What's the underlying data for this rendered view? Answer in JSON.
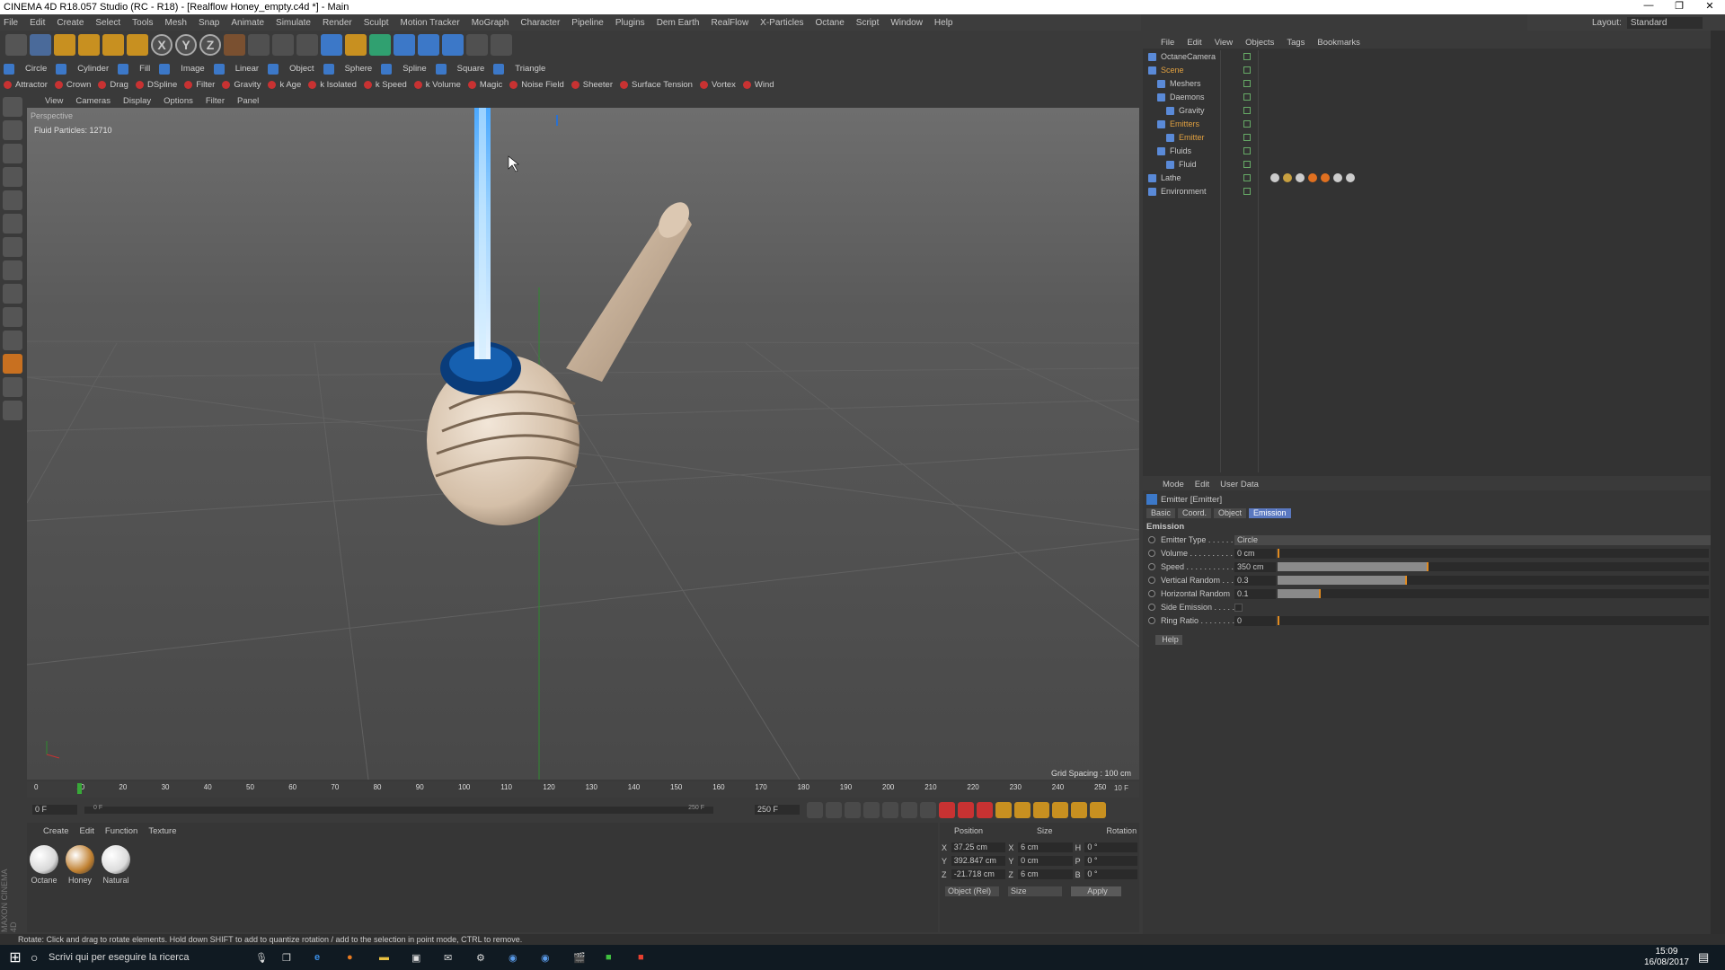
{
  "window": {
    "title": "CINEMA 4D R18.057 Studio (RC - R18) - [Realflow Honey_empty.c4d *] - Main",
    "buttons": [
      "—",
      "❐",
      "✕"
    ]
  },
  "menubar": [
    "File",
    "Edit",
    "Create",
    "Select",
    "Tools",
    "Mesh",
    "Snap",
    "Animate",
    "Simulate",
    "Render",
    "Sculpt",
    "Motion Tracker",
    "MoGraph",
    "Character",
    "Pipeline",
    "Plugins",
    "Dem Earth",
    "RealFlow",
    "X-Particles",
    "Octane",
    "Script",
    "Window",
    "Help"
  ],
  "layout": {
    "label": "Layout:",
    "value": "Standard"
  },
  "toolbar1": [
    "undo",
    "select",
    "move",
    "scale",
    "rotate",
    "rotate2",
    "X",
    "Y",
    "Z",
    "coord",
    "render-view",
    "render",
    "render-settings",
    "cube",
    "pen",
    "subdiv",
    "array",
    "deformer",
    "scene",
    "camera",
    "light"
  ],
  "toolbar2": [
    "Circle",
    "Cylinder",
    "Fill",
    "Image",
    "Linear",
    "Object",
    "Sphere",
    "Spline",
    "Square",
    "Triangle"
  ],
  "toolbar3": [
    "Attractor",
    "Crown",
    "Drag",
    "DSpline",
    "Filter",
    "Gravity",
    "k Age",
    "k Isolated",
    "k Speed",
    "k Volume",
    "Magic",
    "Noise Field",
    "Sheeter",
    "Surface Tension",
    "Vortex",
    "Wind"
  ],
  "viewport": {
    "menu": [
      "View",
      "Cameras",
      "Display",
      "Options",
      "Filter",
      "Panel"
    ],
    "label": "Perspective",
    "particles": "Fluid Particles: 12710",
    "grid_spacing": "Grid Spacing : 100 cm"
  },
  "timeline": {
    "ticks": [
      "0",
      "10",
      "20",
      "30",
      "40",
      "50",
      "60",
      "70",
      "80",
      "90",
      "100",
      "110",
      "120",
      "130",
      "140",
      "150",
      "160",
      "170",
      "180",
      "190",
      "200",
      "210",
      "220",
      "230",
      "240",
      "250"
    ],
    "end_frame_label": "10 F",
    "current": "0 F",
    "start": "0 F",
    "range_end": "250 F",
    "range_end2": "250 F"
  },
  "material_manager": {
    "menu": [
      "Create",
      "Edit",
      "Function",
      "Texture"
    ],
    "materials": [
      {
        "name": "Octane",
        "color": "#d8d8d8"
      },
      {
        "name": "Honey",
        "color": "#c08030"
      },
      {
        "name": "Natural",
        "color": "#dcdcdc"
      }
    ]
  },
  "coordinates": {
    "headers": [
      "Position",
      "Size",
      "Rotation"
    ],
    "rows": [
      {
        "axis": "X",
        "pos": "37.25 cm",
        "size_axis": "X",
        "size": "6 cm",
        "rot_axis": "H",
        "rot": "0 °"
      },
      {
        "axis": "Y",
        "pos": "392.847 cm",
        "size_axis": "Y",
        "size": "0 cm",
        "rot_axis": "P",
        "rot": "0 °"
      },
      {
        "axis": "Z",
        "pos": "-21.718 cm",
        "size_axis": "Z",
        "size": "6 cm",
        "rot_axis": "B",
        "rot": "0 °"
      }
    ],
    "mode": "Object (Rel)",
    "size_mode": "Size",
    "apply": "Apply"
  },
  "object_manager": {
    "menu": [
      "File",
      "Edit",
      "View",
      "Objects",
      "Tags",
      "Bookmarks"
    ],
    "objects": [
      {
        "name": "OctaneCamera",
        "indent": 0,
        "color": "#c8c8c8"
      },
      {
        "name": "Scene",
        "indent": 0,
        "color": "#e0a040"
      },
      {
        "name": "Meshers",
        "indent": 1,
        "color": "#c8c8c8"
      },
      {
        "name": "Daemons",
        "indent": 1,
        "color": "#c8c8c8"
      },
      {
        "name": "Gravity",
        "indent": 2,
        "color": "#c8c8c8"
      },
      {
        "name": "Emitters",
        "indent": 1,
        "color": "#e0a040"
      },
      {
        "name": "Emitter",
        "indent": 2,
        "color": "#e0a040"
      },
      {
        "name": "Fluids",
        "indent": 1,
        "color": "#c8c8c8"
      },
      {
        "name": "Fluid",
        "indent": 2,
        "color": "#c8c8c8"
      },
      {
        "name": "Lathe",
        "indent": 0,
        "color": "#c8c8c8"
      },
      {
        "name": "Environment",
        "indent": 0,
        "color": "#c8c8c8"
      }
    ]
  },
  "attributes": {
    "menu": [
      "Mode",
      "Edit",
      "User Data"
    ],
    "object_title": "Emitter [Emitter]",
    "tabs": [
      "Basic",
      "Coord.",
      "Object",
      "Emission"
    ],
    "active_tab": "Emission",
    "section": "Emission",
    "rows": [
      {
        "label": "Emitter Type . . . . . .",
        "value": "Circle",
        "type": "dropdown"
      },
      {
        "label": "Volume . . . . . . . . . .",
        "value": "0 cm",
        "type": "slider",
        "fraction": 0.0
      },
      {
        "label": "Speed . . . . . . . . . . .",
        "value": "350 cm",
        "type": "slider",
        "fraction": 0.35
      },
      {
        "label": "Vertical Random . . .",
        "value": "0.3",
        "type": "slider",
        "fraction": 0.3
      },
      {
        "label": "Horizontal Random",
        "value": "0.1",
        "type": "slider",
        "fraction": 0.1
      },
      {
        "label": "Side Emission . . . . .",
        "value": "",
        "type": "checkbox"
      },
      {
        "label": "Ring Ratio . . . . . . . .",
        "value": "0",
        "type": "slider",
        "fraction": 0.0
      }
    ],
    "help": "Help"
  },
  "statusbar": "Rotate: Click and drag to rotate elements. Hold down SHIFT to add to quantize rotation / add to the selection in point mode, CTRL to remove.",
  "taskbar": {
    "search": "Scrivi qui per eseguire la ricerca",
    "time": "15:09",
    "date": "16/08/2017"
  },
  "brand": "MAXON CINEMA 4D"
}
